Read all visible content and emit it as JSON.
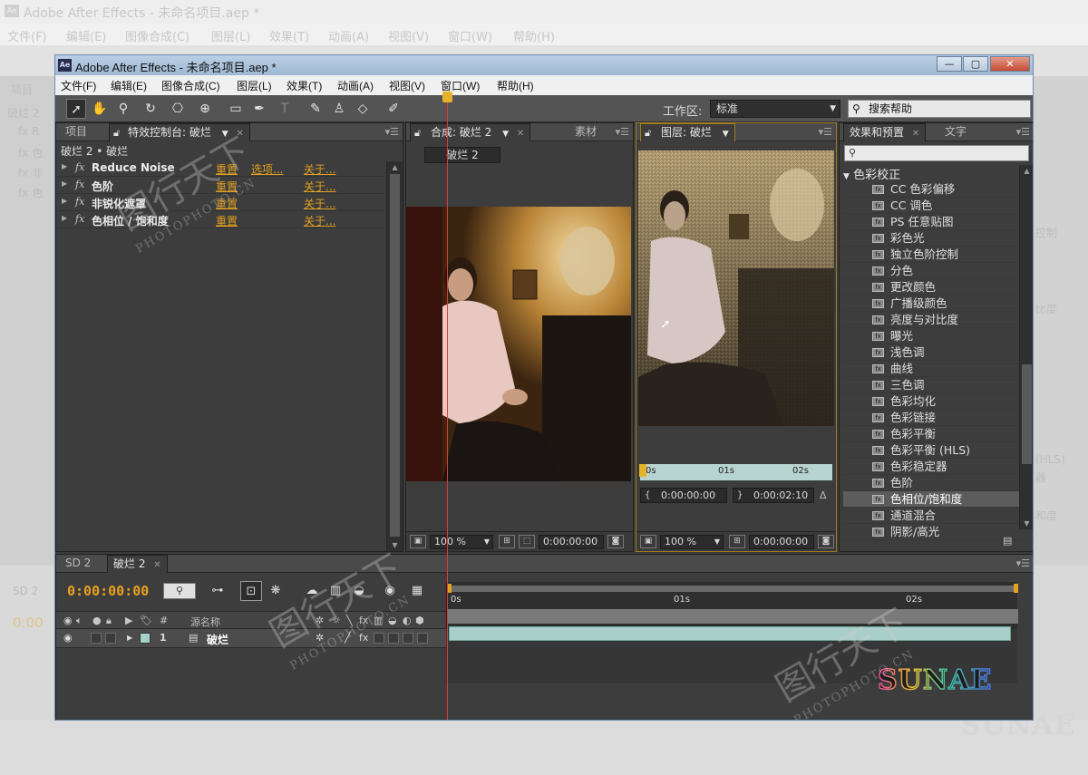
{
  "background_app": {
    "title": "Adobe After Effects - 未命名项目.aep *",
    "menu": [
      "文件(F)",
      "编辑(E)",
      "图像合成(C)",
      "图层(L)",
      "效果(T)",
      "动画(A)",
      "视图(V)",
      "窗口(W)",
      "帮助(H)"
    ],
    "ghost_left": [
      "项目",
      "破烂 2",
      "fx R",
      "fx 色",
      "fx 非",
      "fx 色"
    ],
    "ghost_right": [
      "控制",
      "比度",
      "(HLS)",
      "器",
      "和度"
    ],
    "ghost_timeline": [
      "SD 2",
      "0:00"
    ],
    "ghost_logo": "SUNAE"
  },
  "window": {
    "title": "Adobe After Effects - 未命名项目.aep *",
    "app_icon": "Ae",
    "controls": {
      "minimize": "—",
      "maximize": "▢",
      "close": "✕"
    }
  },
  "menu": [
    "文件(F)",
    "编辑(E)",
    "图像合成(C)",
    "图层(L)",
    "效果(T)",
    "动画(A)",
    "视图(V)",
    "窗口(W)",
    "帮助(H)"
  ],
  "toolbar": {
    "tools": [
      "selection-tool",
      "hand-tool",
      "zoom-tool",
      "rotate-tool",
      "camera-tool",
      "pan-behind-tool",
      "rectangle-tool",
      "pen-tool",
      "text-tool",
      "brush-tool",
      "clone-stamp-tool",
      "eraser-tool",
      "roto-brush-tool"
    ],
    "workspace_label": "工作区:",
    "workspace_value": "标准",
    "search_help": "搜索帮助"
  },
  "effect_controls": {
    "tabs": [
      "项目",
      "特效控制台: 破烂"
    ],
    "subtitle": "破烂 2 • 破烂",
    "effects": [
      {
        "name": "Reduce Noise",
        "reset": "重置",
        "options": "选项...",
        "about": "关于..."
      },
      {
        "name": "色阶",
        "reset": "重置",
        "options": "",
        "about": "关于..."
      },
      {
        "name": "非锐化遮罩",
        "reset": "重置",
        "options": "",
        "about": "关于..."
      },
      {
        "name": "色相位 / 饱和度",
        "reset": "重置",
        "options": "",
        "about": "关于..."
      }
    ]
  },
  "comp_viewer": {
    "tabs": [
      "合成: 破烂 2",
      "素材"
    ],
    "comp_label": "破烂 2",
    "zoom": "100 %",
    "time": "0:00:00:00"
  },
  "layer_viewer": {
    "tab": "图层: 破烂",
    "ruler_labels": [
      "0s",
      "01s",
      "02s"
    ],
    "in_point": "0:00:00:00",
    "duration": "0:00:02:10",
    "zoom": "100 %",
    "time": "0:00:00:00"
  },
  "effects_presets": {
    "tabs": [
      "效果和预置",
      "文字"
    ],
    "search_placeholder": "",
    "category": "色彩校正",
    "items": [
      "CC 色彩偏移",
      "CC 调色",
      "PS 任意贴图",
      "彩色光",
      "独立色阶控制",
      "分色",
      "更改颜色",
      "广播级颜色",
      "亮度与对比度",
      "曝光",
      "浅色调",
      "曲线",
      "三色调",
      "色彩均化",
      "色彩链接",
      "色彩平衡",
      "色彩平衡 (HLS)",
      "色彩稳定器",
      "色阶",
      "色相位/饱和度",
      "通道混合",
      "阴影/高光"
    ],
    "selected": "色相位/饱和度"
  },
  "timeline": {
    "tabs": [
      "SD 2",
      "破烂 2"
    ],
    "timecode": "0:00:00:00",
    "column_header_name": "源名称",
    "column_number": "#",
    "layer": {
      "number": "1",
      "name": "破烂"
    },
    "ruler_labels": [
      "0s",
      "01s",
      "02s"
    ],
    "label_color": "#a6d3c9"
  },
  "watermarks": {
    "brand": "图行天下",
    "site": "PHOTOPHOTO.CN"
  },
  "logo_text": "SUNAE",
  "colors": {
    "accent_orange": "#e8a21d",
    "playhead": "#e03a3a",
    "panel_bg": "#3d3d3d",
    "title_bar": "#b9cfe4"
  }
}
